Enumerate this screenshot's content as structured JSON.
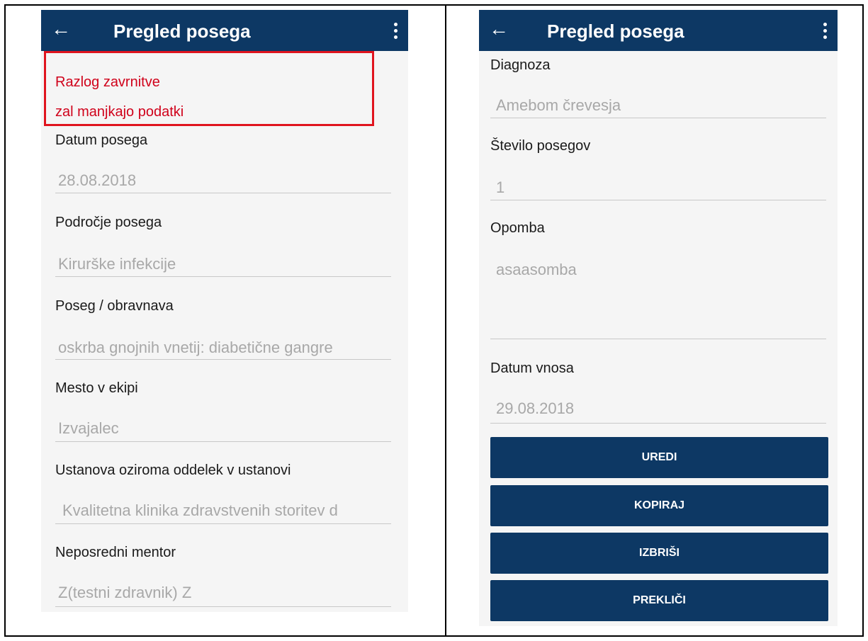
{
  "left": {
    "appbar": {
      "title": "Pregled posega"
    },
    "alert": {
      "line1": "Razlog zavrnitve",
      "line2": "zal manjkajo podatki"
    },
    "fields": [
      {
        "label": "Datum posega",
        "value": "28.08.2018"
      },
      {
        "label": "Področje posega",
        "value": "Kirurške infekcije"
      },
      {
        "label": "Poseg / obravnava",
        "value": "oskrba gnojnih vnetij: diabetične gangre"
      },
      {
        "label": "Mesto v ekipi",
        "value": "Izvajalec"
      },
      {
        "label": "Ustanova oziroma oddelek v ustanovi",
        "value": "Kvalitetna klinika zdravstvenih storitev d"
      },
      {
        "label": "Neposredni mentor",
        "value": "Z(testni zdravnik) Z"
      }
    ]
  },
  "right": {
    "appbar": {
      "title": "Pregled posega"
    },
    "fields": [
      {
        "label": "Diagnoza",
        "value": "Amebom črevesja"
      },
      {
        "label": "Število posegov",
        "value": "1"
      },
      {
        "label": "Opomba",
        "value": "asaasomba"
      },
      {
        "label": "Datum vnosa",
        "value": "29.08.2018"
      }
    ],
    "buttons": {
      "edit": "UREDI",
      "copy": "KOPIRAJ",
      "delete": "IZBRIŠI",
      "cancel": "PREKLIČI"
    }
  }
}
